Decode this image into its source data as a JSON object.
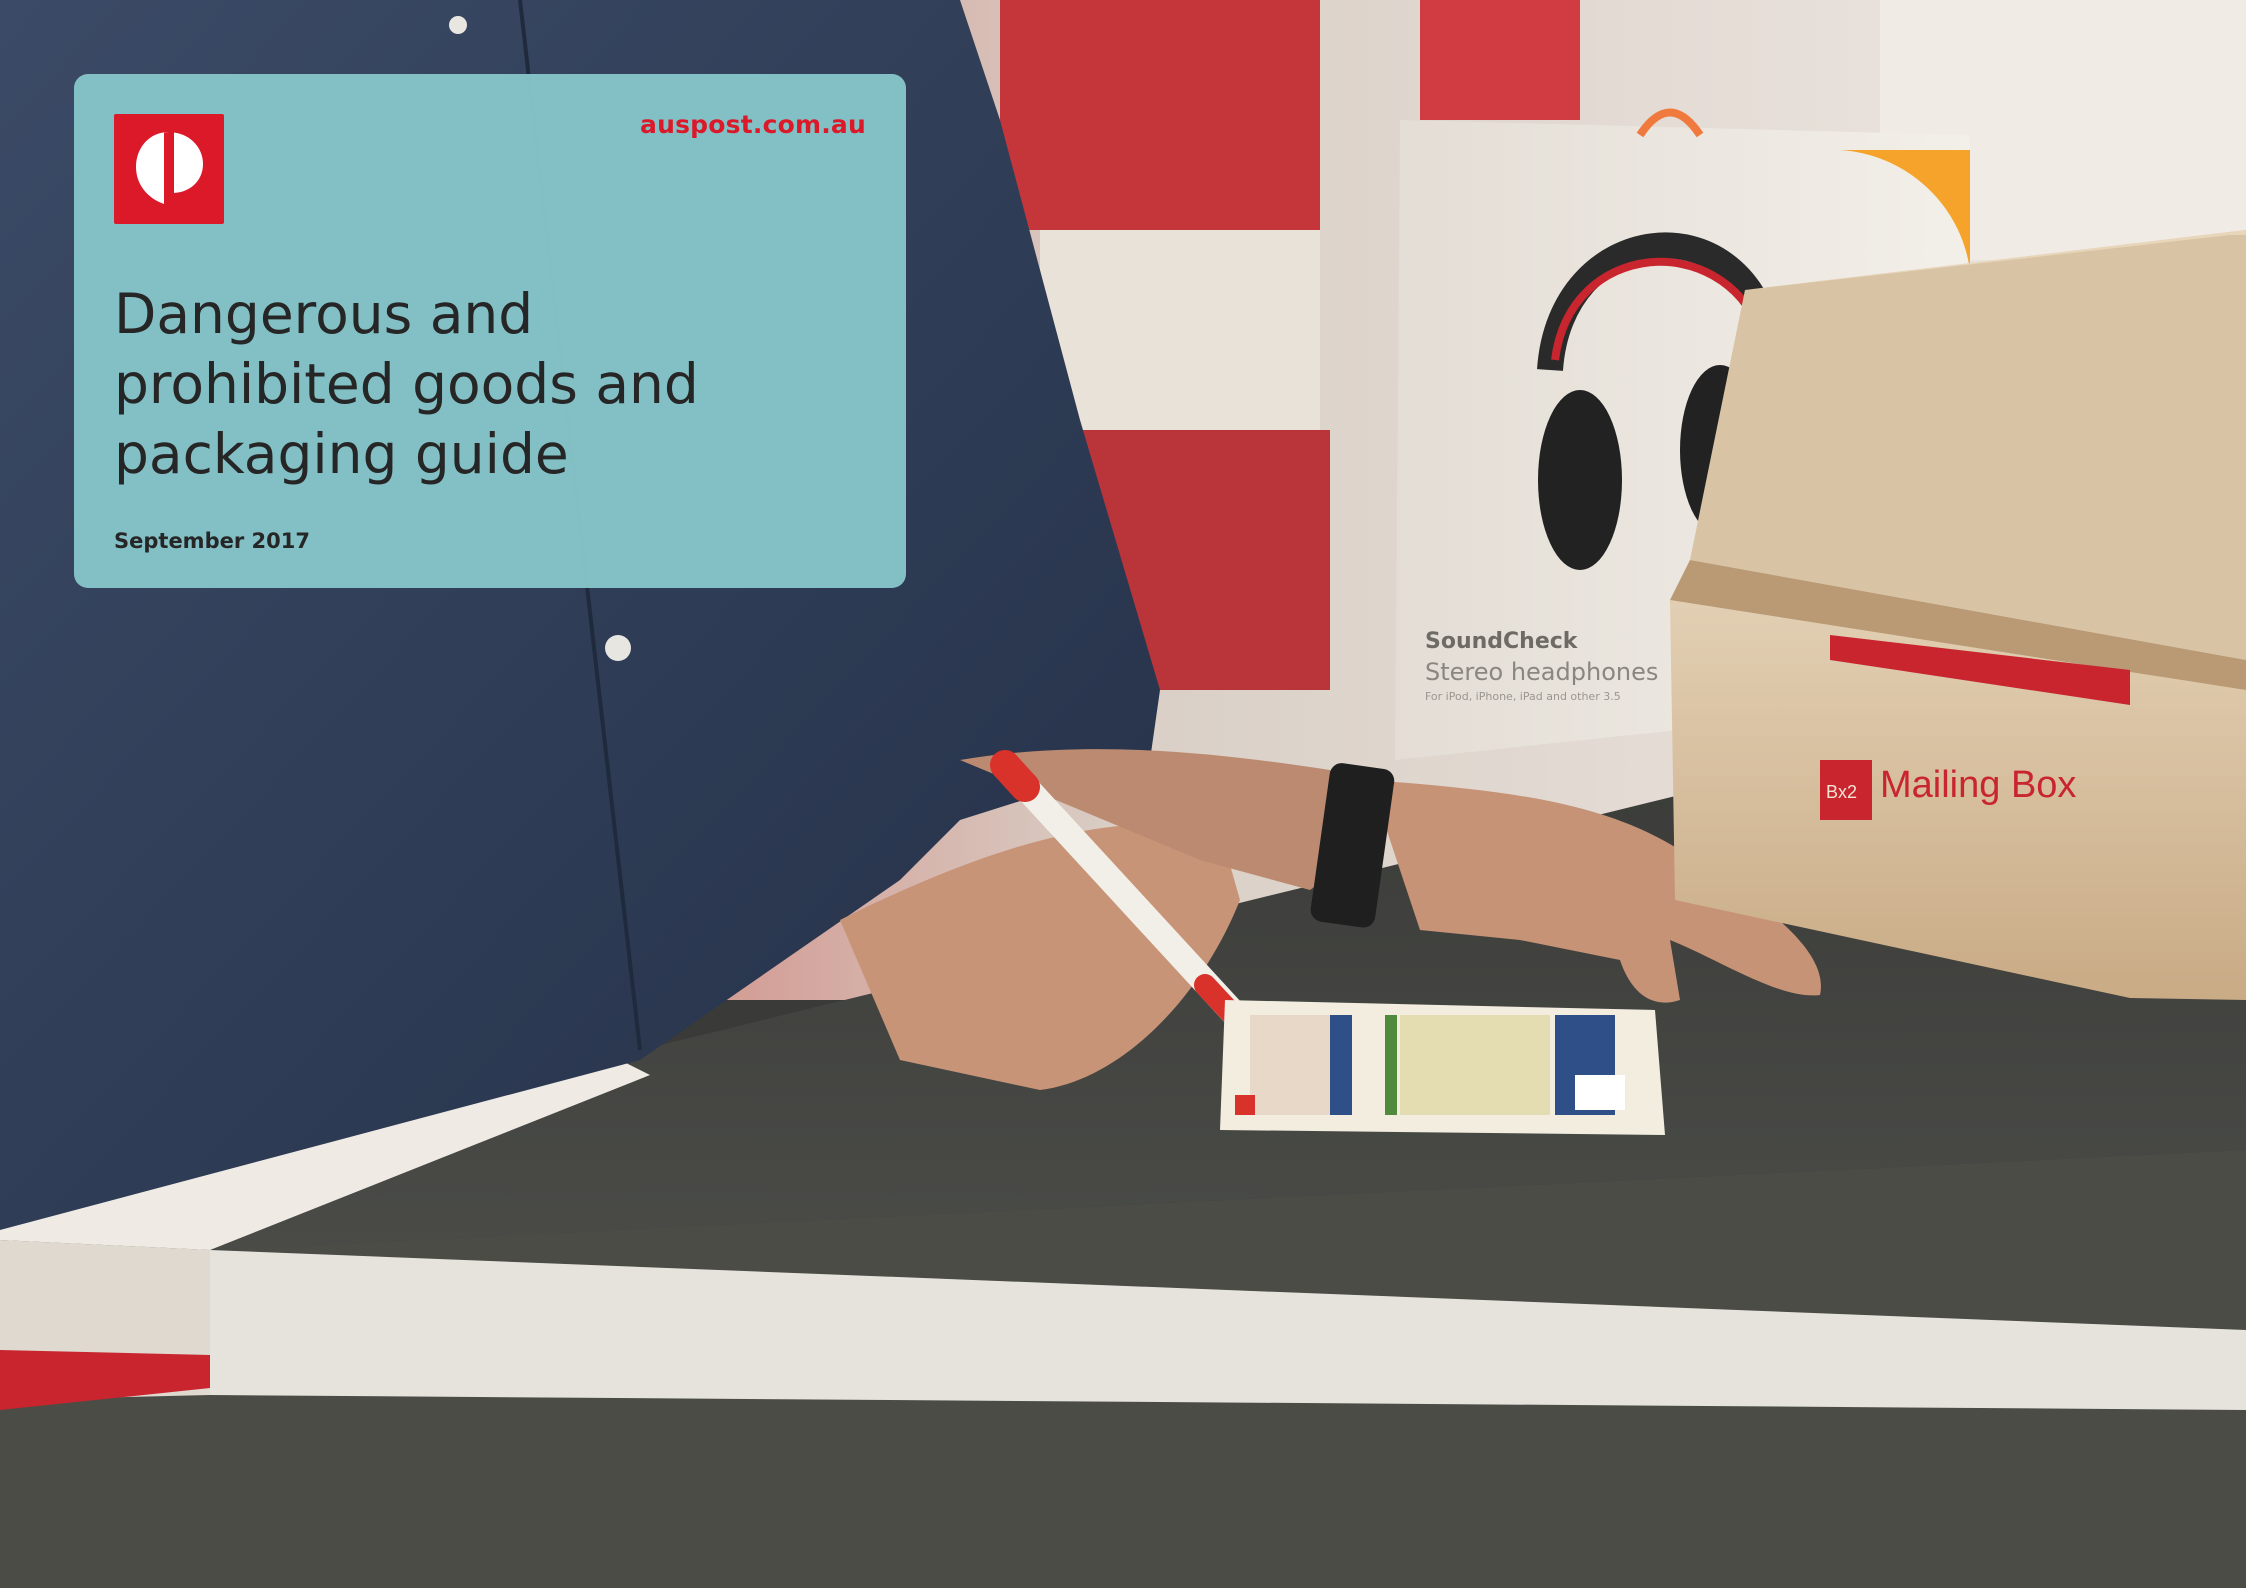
{
  "brand": {
    "logo_name": "australia-post-logo",
    "url": "auspost.com.au",
    "accent_color": "#dc1928",
    "panel_color": "#87c7cb"
  },
  "cover": {
    "title": "Dangerous and\nprohibited goods and\npackaging guide",
    "date": "September 2017"
  },
  "photo": {
    "headphones_box": {
      "brand": "SoundCheck",
      "product": "Stereo headphones",
      "sub": "For iPod, iPhone, iPad and other 3.5"
    },
    "mailing_box": {
      "size": "Bx2",
      "label": "Mailing Box"
    }
  }
}
